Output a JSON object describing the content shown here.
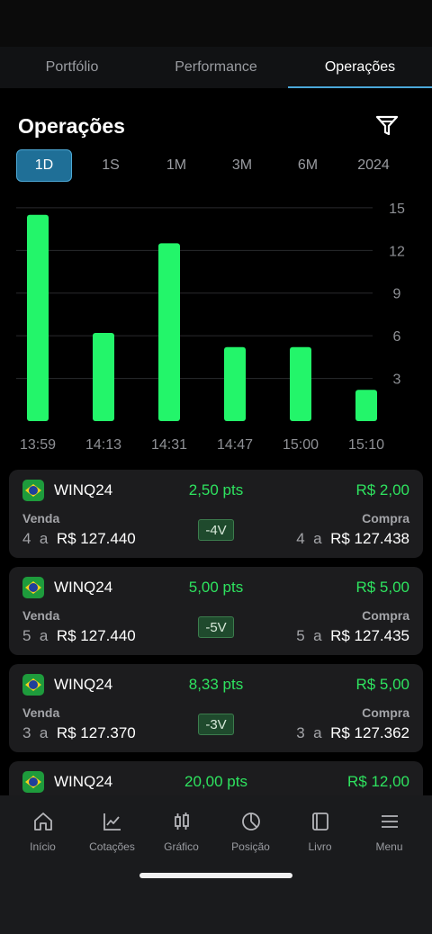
{
  "tabs": [
    {
      "label": "Portfólio",
      "active": false
    },
    {
      "label": "Performance",
      "active": false
    },
    {
      "label": "Operações",
      "active": true
    }
  ],
  "page_title": "Operações",
  "filter_icon": "filter-icon",
  "periods": [
    {
      "label": "1D",
      "active": true
    },
    {
      "label": "1S",
      "active": false
    },
    {
      "label": "1M",
      "active": false
    },
    {
      "label": "3M",
      "active": false
    },
    {
      "label": "6M",
      "active": false
    },
    {
      "label": "2024",
      "active": false
    }
  ],
  "chart_data": {
    "type": "bar",
    "categories": [
      "13:59",
      "14:13",
      "14:31",
      "14:47",
      "15:00",
      "15:10"
    ],
    "values": [
      14.5,
      6.2,
      12.5,
      5.2,
      5.2,
      2.2
    ],
    "yticks": [
      15,
      12,
      9,
      6,
      3
    ],
    "ylim": [
      0,
      15.5
    ],
    "grid": true,
    "bar_color": "#23f56a"
  },
  "operations": [
    {
      "symbol": "WINQ24",
      "points": "2,50 pts",
      "amount": "R$ 2,00",
      "sell_label": "Venda",
      "sell_qty": "4",
      "sell_sep": "a",
      "sell_price": "R$ 127.440",
      "badge": "-4V",
      "buy_label": "Compra",
      "buy_qty": "4",
      "buy_sep": "a",
      "buy_price": "R$ 127.438"
    },
    {
      "symbol": "WINQ24",
      "points": "5,00 pts",
      "amount": "R$ 5,00",
      "sell_label": "Venda",
      "sell_qty": "5",
      "sell_sep": "a",
      "sell_price": "R$ 127.440",
      "badge": "-5V",
      "buy_label": "Compra",
      "buy_qty": "5",
      "buy_sep": "a",
      "buy_price": "R$ 127.435"
    },
    {
      "symbol": "WINQ24",
      "points": "8,33 pts",
      "amount": "R$ 5,00",
      "sell_label": "Venda",
      "sell_qty": "3",
      "sell_sep": "a",
      "sell_price": "R$ 127.370",
      "badge": "-3V",
      "buy_label": "Compra",
      "buy_qty": "3",
      "buy_sep": "a",
      "buy_price": "R$ 127.362"
    },
    {
      "symbol": "WINQ24",
      "points": "20,00 pts",
      "amount": "R$ 12,00"
    }
  ],
  "bottom_nav": [
    {
      "label": "Início",
      "icon": "home-icon"
    },
    {
      "label": "Cotações",
      "icon": "line-chart-icon"
    },
    {
      "label": "Gráfico",
      "icon": "candlestick-icon"
    },
    {
      "label": "Posição",
      "icon": "pie-chart-icon"
    },
    {
      "label": "Livro",
      "icon": "book-icon"
    },
    {
      "label": "Menu",
      "icon": "menu-icon"
    }
  ],
  "colors": {
    "accent": "#4aa7d9",
    "positive": "#2ee35f",
    "card_bg": "#1c1c1e",
    "badge_bg": "#1f4a2d"
  }
}
